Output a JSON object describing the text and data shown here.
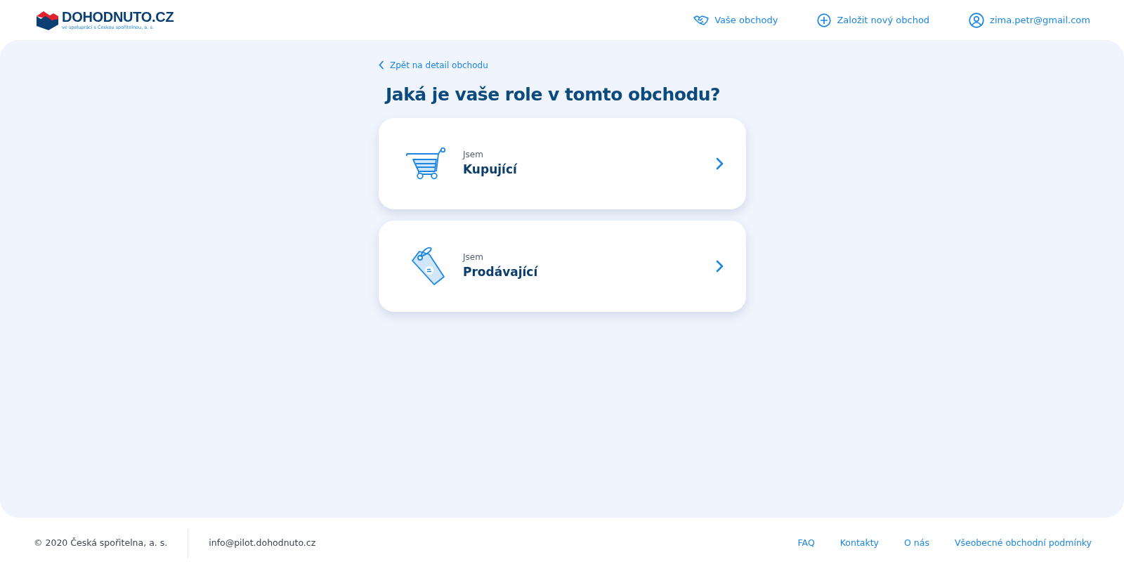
{
  "logo": {
    "name": "DOHODNUTO.CZ",
    "tagline": "ve spolupráci s Českou spořitelnou, a. s."
  },
  "nav": [
    {
      "label": "Vaše obchody"
    },
    {
      "label": "Založit nový obchod"
    },
    {
      "label": "zima.petr@gmail.com"
    }
  ],
  "back_link": "Zpět na detail obchodu",
  "title": "Jaká je vaše role v tomto obchodu?",
  "roles": [
    {
      "prefix": "Jsem",
      "label": "Kupující"
    },
    {
      "prefix": "Jsem",
      "label": "Prodávající"
    }
  ],
  "footer": {
    "copyright": "© 2020 Česká spořitelna, a. s.",
    "email": "info@pilot.dohodnuto.cz",
    "links": [
      "FAQ",
      "Kontakty",
      "O nás",
      "Všeobecné obchodní podmínky"
    ]
  }
}
